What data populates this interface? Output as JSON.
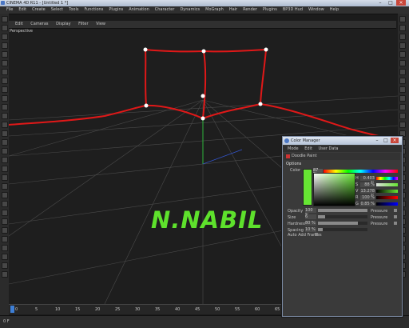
{
  "window": {
    "title": "CINEMA 4D R11 - [Untitled 1 *]",
    "min": "–",
    "max": "□",
    "close": "×"
  },
  "menubar": {
    "items": [
      "File",
      "Edit",
      "Create",
      "Select",
      "Tools",
      "Functions",
      "Plugins",
      "Animation",
      "Character",
      "Dynamics",
      "MoGraph",
      "Hair",
      "Render",
      "Plugins",
      "BP3D Hud",
      "Window",
      "Help"
    ]
  },
  "viewport": {
    "menu": [
      "Edit",
      "Cameras",
      "Display",
      "Filter",
      "View"
    ],
    "label": "Perspective",
    "signature": "N.NABIL",
    "colors": {
      "spline": "#e01818",
      "signature": "#5ee12c",
      "axis_y": "#2db43c",
      "grid": "#4a4a4a"
    }
  },
  "timeline": {
    "ticks": [
      "0",
      "5",
      "10",
      "15",
      "20",
      "25",
      "30",
      "35",
      "40",
      "45",
      "50",
      "55",
      "60",
      "65",
      "70",
      "75",
      "80",
      "85",
      "90"
    ],
    "frame": "0 F"
  },
  "color_manager": {
    "title": "Color Manager",
    "menu": [
      "Mode",
      "Edit",
      "User Data"
    ],
    "object": "Doodle Paint",
    "section": "Options",
    "color_label": "Color",
    "percent": "87 %",
    "accent": "#66e633",
    "hsv": [
      {
        "key": "H",
        "value": "0.403 %"
      },
      {
        "key": "S",
        "value": "88 %"
      },
      {
        "key": "V",
        "value": "13.278 %"
      },
      {
        "key": "R",
        "value": "100 %"
      },
      {
        "key": "G",
        "value": "0.85 %"
      }
    ],
    "params": [
      {
        "key": "Opacity",
        "value": "100 %",
        "level": 1.0,
        "pressure": "Pressure"
      },
      {
        "key": "Size",
        "value": "6",
        "level": 0.15,
        "pressure": "Pressure"
      },
      {
        "key": "Hardness",
        "value": "80 %",
        "level": 0.8,
        "pressure": "Pressure"
      },
      {
        "key": "Spacing",
        "value": "10 %",
        "level": 0.1,
        "pressure": ""
      }
    ],
    "auto_add": "Auto Add Frames"
  }
}
